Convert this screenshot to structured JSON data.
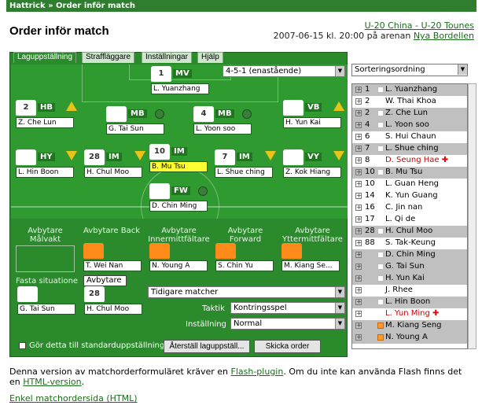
{
  "breadcrumb": "Hattrick » Order inför match",
  "page_title": "Order inför match",
  "match_link": "U-20 China - U-20 Tounes",
  "date_text": "2007-06-15 kl. 20:00 på arenan",
  "arena_link": "Nya Bordellen",
  "tabs": [
    "Laguppställning",
    "Straffläggare",
    "Inställningar",
    "Hjälp"
  ],
  "formation": "4-5-1 (enastående)",
  "players": {
    "mv": {
      "num": "1",
      "pos": "MV",
      "name": "L. Yuanzhang"
    },
    "hb": {
      "num": "2",
      "pos": "HB",
      "name": "Z. Che Lun"
    },
    "mb1": {
      "num": "",
      "pos": "MB",
      "name": "G. Tai Sun"
    },
    "mb2": {
      "num": "4",
      "pos": "MB",
      "name": "L. Yoon soo"
    },
    "vb": {
      "num": "",
      "pos": "VB",
      "name": "H. Yun Kai"
    },
    "hy": {
      "num": "",
      "pos": "HY",
      "name": "L. Hin Boon"
    },
    "im1": {
      "num": "28",
      "pos": "IM",
      "name": "H. Chul Moo"
    },
    "im2": {
      "num": "10",
      "pos": "IM",
      "name": "B. Mu Tsu"
    },
    "im3": {
      "num": "7",
      "pos": "IM",
      "name": "L. Shue ching"
    },
    "vy": {
      "num": "",
      "pos": "VY",
      "name": "Z. Kok Hiang"
    },
    "fw": {
      "num": "",
      "pos": "FW",
      "name": "D. Chin Ming"
    }
  },
  "subs": {
    "labels": [
      "Avbytare Målvakt",
      "Avbytare Back",
      "Avbytare Innermittfältare",
      "Avbytare Forward",
      "Avbytare Yttermittfältare"
    ],
    "names": [
      "",
      "T. Wei Nan",
      "N. Young A",
      "S. Chin Yu",
      "M. Kiang Se..."
    ],
    "set_pieces_label": "Fasta situationer",
    "tooltip": "Avbytare",
    "set_piece_names": [
      "G. Tai Sun",
      "H. Chul Moo"
    ],
    "set_piece_nums": [
      "",
      "28"
    ]
  },
  "earlier_matches": "Tidigare matcher",
  "tactic_label": "Taktik",
  "tactic_value": "Kontringsspel",
  "setting_label": "Inställning",
  "setting_value": "Normal",
  "default_check_label": "Gör detta till standarduppställning",
  "reset_button": "Återställ laguppställ...",
  "send_button": "Skicka order",
  "sort_label": "Sorteringsordning",
  "roster": [
    {
      "num": "1",
      "name": "L. Yuanzhang",
      "g": true
    },
    {
      "num": "2",
      "name": "W. Thai Khoa"
    },
    {
      "num": "2",
      "name": "Z. Che Lun",
      "g": true
    },
    {
      "num": "4",
      "name": "L. Yoon soo",
      "g": true
    },
    {
      "num": "6",
      "name": "S. Hui Chaun"
    },
    {
      "num": "7",
      "name": "L. Shue ching",
      "g": true
    },
    {
      "num": "8",
      "name": "D. Seung Hae",
      "red": true
    },
    {
      "num": "10",
      "name": "B. Mu Tsu",
      "g": true
    },
    {
      "num": "10",
      "name": "L. Guan Heng"
    },
    {
      "num": "14",
      "name": "K. Yun Guang"
    },
    {
      "num": "16",
      "name": "C. Jin nan"
    },
    {
      "num": "17",
      "name": "L. Qi de"
    },
    {
      "num": "28",
      "name": "H. Chul Moo",
      "g": true
    },
    {
      "num": "88",
      "name": "S. Tak-Keung"
    },
    {
      "num": "",
      "name": "D. Chin Ming",
      "g": true
    },
    {
      "num": "",
      "name": "G. Tai Sun",
      "g": true
    },
    {
      "num": "",
      "name": "H. Yun Kai",
      "g": true
    },
    {
      "num": "",
      "name": "J. Rhee"
    },
    {
      "num": "",
      "name": "L. Hin Boon",
      "g": true
    },
    {
      "num": "",
      "name": "L. Yun Ming",
      "red": true
    },
    {
      "num": "",
      "name": "M. Kiang Seng",
      "o": true,
      "g": true
    },
    {
      "num": "",
      "name": "N. Young A",
      "o": true,
      "g": true
    }
  ],
  "footer_text_before": "Denna version av matchorderformuläret kräver en ",
  "flash_link": "Flash-plugin",
  "footer_text_mid": ". Om du inte kan använda Flash finns det en ",
  "html_link": "HTML-version",
  "footer_text_end": ".",
  "simple_link": "Enkel matchordersida (HTML)"
}
